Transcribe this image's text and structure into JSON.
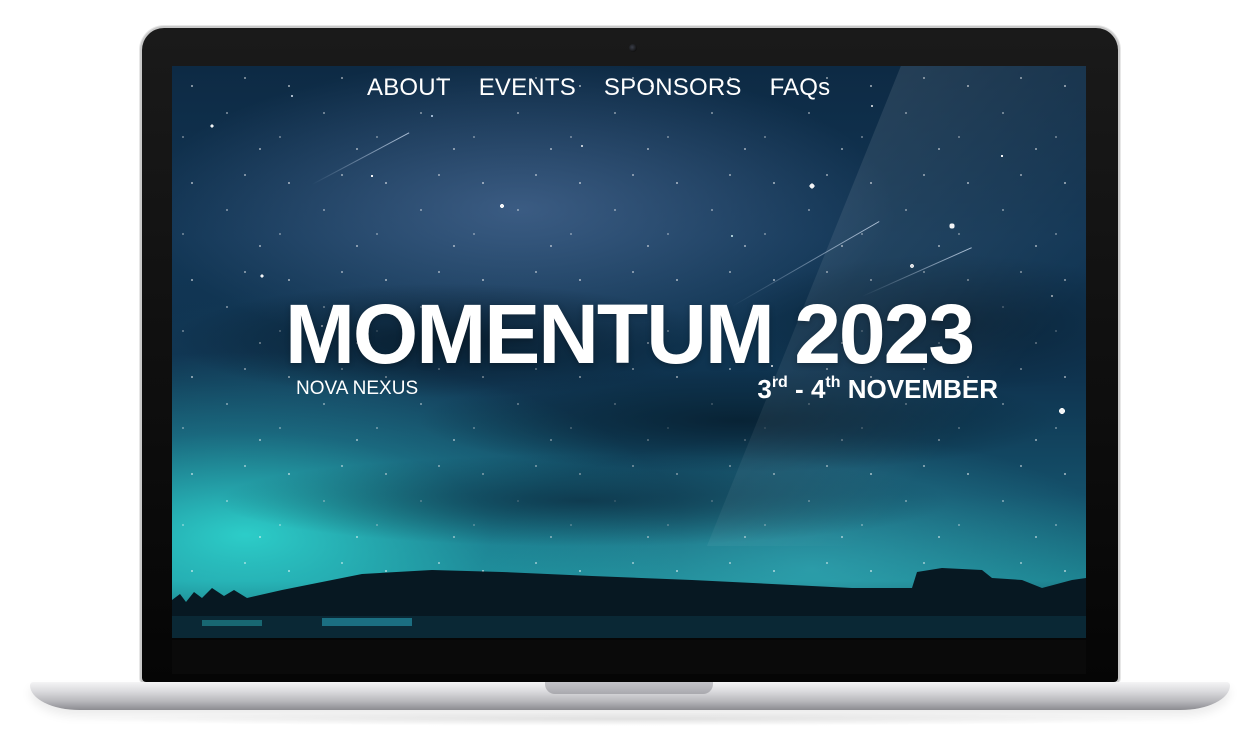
{
  "nav": {
    "items": [
      {
        "label": "ABOUT"
      },
      {
        "label": "EVENTS"
      },
      {
        "label": "SPONSORS"
      },
      {
        "label": "FAQs"
      }
    ]
  },
  "hero": {
    "title": "MOMENTUM 2023",
    "organizer": "NOVA NEXUS",
    "date": {
      "start_day": "3",
      "start_suffix": "rd",
      "separator": " - ",
      "end_day": "4",
      "end_suffix": "th",
      "month": "NOVEMBER"
    }
  },
  "colors": {
    "text": "#ffffff",
    "sky_dark": "#0d2a44",
    "sky_teal": "#30dfd6",
    "laptop_bezel": "#0a0a0a",
    "laptop_silver": "#d9d9dc"
  }
}
